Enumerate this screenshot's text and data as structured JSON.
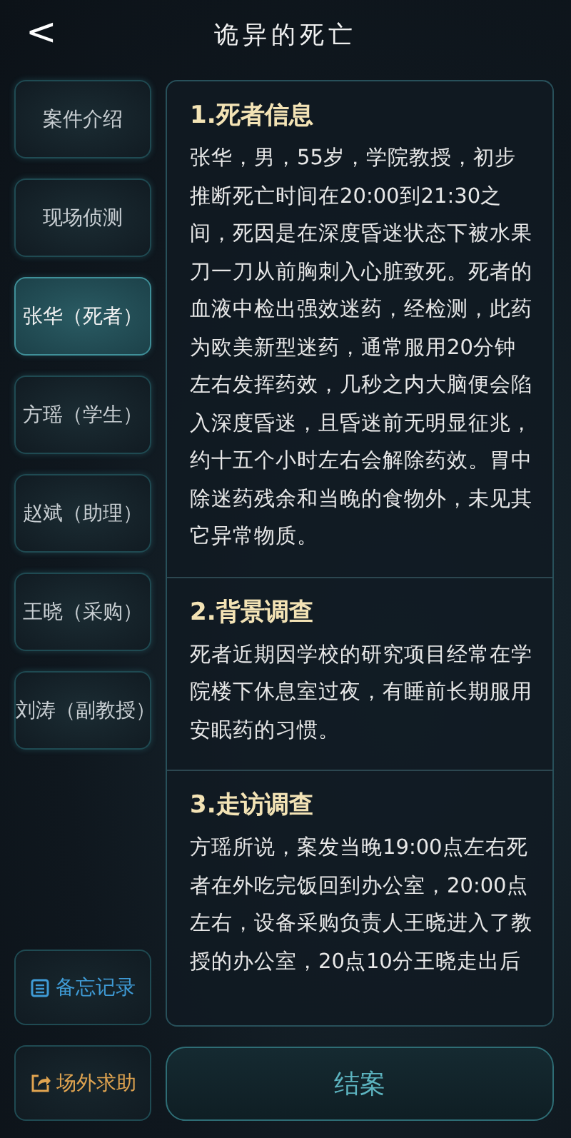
{
  "header": {
    "back": "<",
    "title": "诡异的死亡"
  },
  "sidebar": {
    "items": [
      {
        "label": "案件介绍",
        "selected": false
      },
      {
        "label": "现场侦测",
        "selected": false
      },
      {
        "label": "张华（死者）",
        "selected": true
      },
      {
        "label": "方瑶（学生）",
        "selected": false
      },
      {
        "label": "赵斌（助理）",
        "selected": false
      },
      {
        "label": "王晓（采购）",
        "selected": false
      },
      {
        "label": "刘涛（副教授）",
        "selected": false
      }
    ],
    "tools": [
      {
        "kind": "memo",
        "label": "备忘记录"
      },
      {
        "kind": "help",
        "label": "场外求助"
      }
    ]
  },
  "sections": [
    {
      "title": "1.死者信息",
      "body": "张华，男，55岁，学院教授，初步推断死亡时间在20:00到21:30之间，死因是在深度昏迷状态下被水果刀一刀从前胸刺入心脏致死。死者的血液中检出强效迷药，经检测，此药为欧美新型迷药，通常服用20分钟左右发挥药效，几秒之内大脑便会陷入深度昏迷，且昏迷前无明显征兆，约十五个小时左右会解除药效。胃中除迷药残余和当晚的食物外，未见其它异常物质。"
    },
    {
      "title": "2.背景调查",
      "body": "死者近期因学校的研究项目经常在学院楼下休息室过夜，有睡前长期服用安眠药的习惯。"
    },
    {
      "title": "3.走访调查",
      "body": "方瑶所说，案发当晚19:00点左右死者在外吃完饭回到办公室，20:00点左右，设备采购负责人王晓进入了教授的办公室，20点10分王晓走出后"
    }
  ],
  "close_case": "结案"
}
